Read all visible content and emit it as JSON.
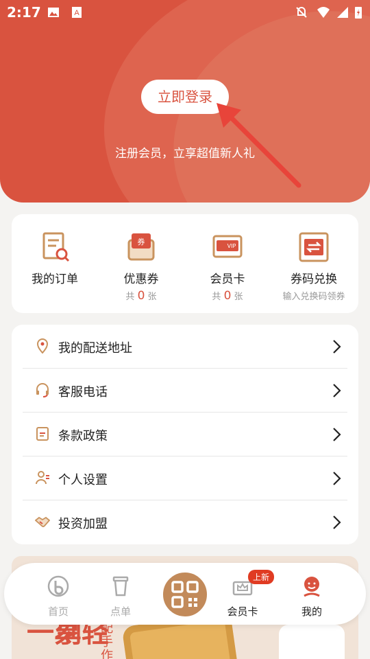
{
  "status": {
    "time": "2:17",
    "icons": [
      "image-icon",
      "a-icon",
      "mute-icon",
      "wifi-icon",
      "signal-icon",
      "battery-icon"
    ]
  },
  "header": {
    "login_label": "立即登录",
    "subtitle": "注册会员，立享超值新人礼"
  },
  "quick_actions": [
    {
      "label": "我的订单",
      "icon": "order-icon"
    },
    {
      "label": "优惠券",
      "icon": "coupon-icon",
      "prefix": "共",
      "count": "0",
      "unit": "张"
    },
    {
      "label": "会员卡",
      "icon": "vip-card-icon",
      "prefix": "共",
      "count": "0",
      "unit": "张"
    },
    {
      "label": "券码兑换",
      "icon": "redeem-icon",
      "sub": "输入兑换码领券"
    }
  ],
  "menu": [
    {
      "label": "我的配送地址",
      "icon": "location-icon"
    },
    {
      "label": "客服电话",
      "icon": "headset-icon"
    },
    {
      "label": "条款政策",
      "icon": "document-icon"
    },
    {
      "label": "个人设置",
      "icon": "user-settings-icon"
    },
    {
      "label": "投资加盟",
      "icon": "handshake-icon"
    }
  ],
  "promo": {
    "big_text": "一刻",
    "big_text2": "享轻",
    "side_text": "配手作"
  },
  "tabbar": {
    "items": [
      {
        "label": "首页",
        "icon": "home-logo-icon"
      },
      {
        "label": "点单",
        "icon": "cup-icon"
      },
      {
        "label": "会员卡",
        "icon": "crown-card-icon",
        "badge": "上新"
      },
      {
        "label": "我的",
        "icon": "profile-icon"
      }
    ],
    "center_icon": "qr-scan-icon"
  },
  "colors": {
    "brand": "#d9533f",
    "accent_gold": "#c28a5a",
    "badge": "#e03b22"
  }
}
